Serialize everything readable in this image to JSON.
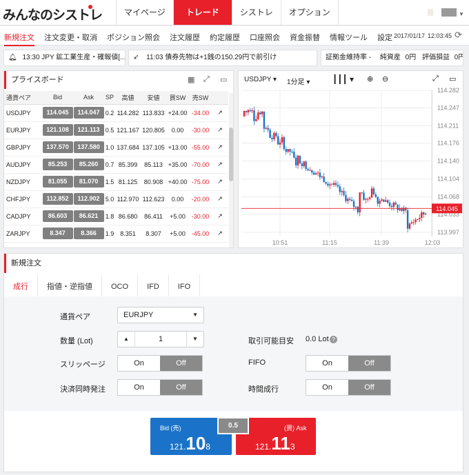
{
  "app": {
    "logo": "みんなのシストレ"
  },
  "global_nav": [
    "マイページ",
    "トレード",
    "シストレ",
    "オプション"
  ],
  "sub_nav": {
    "items": [
      "新規注文",
      "注文変更・取消",
      "ポジション照会",
      "注文履歴",
      "約定履歴",
      "口座照会",
      "資金振替",
      "情報ツール",
      "設定"
    ],
    "date": "2017/01/17",
    "time": "12:03:45"
  },
  "ticker": {
    "news1": "13:30 JPY 鉱工業生産・確報値[...",
    "news2": "11:03 債券先物は+1銭の150.29円で前引け",
    "margin_label": "証拠金維持率 -",
    "equity_label": "純資産",
    "equity_value": "0円",
    "pl_label": "評価損益",
    "pl_value": "0円"
  },
  "price_board": {
    "title": "プライスボード",
    "columns": [
      "通貨ペア",
      "Bid",
      "Ask",
      "SP",
      "高値",
      "安値",
      "買SW",
      "売SW"
    ],
    "rows": [
      {
        "pair": "USDJPY",
        "bid": "114.045",
        "ask": "114.047",
        "sp": "0.2",
        "high": "114.282",
        "low": "113.833",
        "buy_sw": "+24.00",
        "sell_sw": "-34.00"
      },
      {
        "pair": "EURJPY",
        "bid": "121.108",
        "ask": "121.113",
        "sp": "0.5",
        "high": "121.167",
        "low": "120.805",
        "buy_sw": "0.00",
        "sell_sw": "-30.00"
      },
      {
        "pair": "GBPJPY",
        "bid": "137.570",
        "ask": "137.580",
        "sp": "1.0",
        "high": "137.684",
        "low": "137.105",
        "buy_sw": "+13.00",
        "sell_sw": "-55.00"
      },
      {
        "pair": "AUDJPY",
        "bid": "85.253",
        "ask": "85.260",
        "sp": "0.7",
        "high": "85.399",
        "low": "85.113",
        "buy_sw": "+35.00",
        "sell_sw": "-70.00"
      },
      {
        "pair": "NZDJPY",
        "bid": "81.055",
        "ask": "81.070",
        "sp": "1.5",
        "high": "81.125",
        "low": "80.908",
        "buy_sw": "+40.00",
        "sell_sw": "-75.00"
      },
      {
        "pair": "CHFJPY",
        "bid": "112.852",
        "ask": "112.902",
        "sp": "5.0",
        "high": "112.970",
        "low": "112.623",
        "buy_sw": "0.00",
        "sell_sw": "-20.00"
      },
      {
        "pair": "CADJPY",
        "bid": "86.603",
        "ask": "86.621",
        "sp": "1.8",
        "high": "86.680",
        "low": "86.411",
        "buy_sw": "+5.00",
        "sell_sw": "-30.00"
      },
      {
        "pair": "ZARJPY",
        "bid": "8.347",
        "ask": "8.366",
        "sp": "1.9",
        "high": "8.351",
        "low": "8.307",
        "buy_sw": "+5.00",
        "sell_sw": "-45.00"
      }
    ]
  },
  "chart": {
    "pair": "USDJPY",
    "interval": "1分足",
    "current_price": "114.045",
    "y_ticks": [
      "114.282",
      "114.247",
      "114.211",
      "114.176",
      "114.140",
      "114.104",
      "114.068",
      "114.033",
      "113.997"
    ],
    "x_ticks": [
      "10:51",
      "11:15",
      "11:39",
      "12:03"
    ]
  },
  "chart_data": {
    "type": "candlestick",
    "x": [
      "10:51",
      "11:15",
      "11:39",
      "12:03"
    ],
    "ylim": [
      113.997,
      114.282
    ],
    "current": 114.045
  },
  "order": {
    "title": "新規注文",
    "tabs": [
      "成行",
      "指値・逆指値",
      "OCO",
      "IFD",
      "IFO"
    ],
    "pair_label": "通貨ペア",
    "pair_value": "EURJPY",
    "qty_label": "数量 (Lot)",
    "qty_value": "1",
    "tradable_label": "取引可能目安",
    "tradable_value": "0.0 Lot",
    "slippage_label": "スリッページ",
    "fifo_label": "FIFO",
    "settle_label": "決済同時発注",
    "time_label": "時間成行",
    "on": "On",
    "off": "Off",
    "bid_label": "Bid (売)",
    "bid_prefix": "121.",
    "bid_big": "10",
    "bid_small": "8",
    "ask_label": "(買) Ask",
    "ask_prefix": "121.",
    "ask_big": "11",
    "ask_small": "3",
    "spread": "0.5"
  }
}
